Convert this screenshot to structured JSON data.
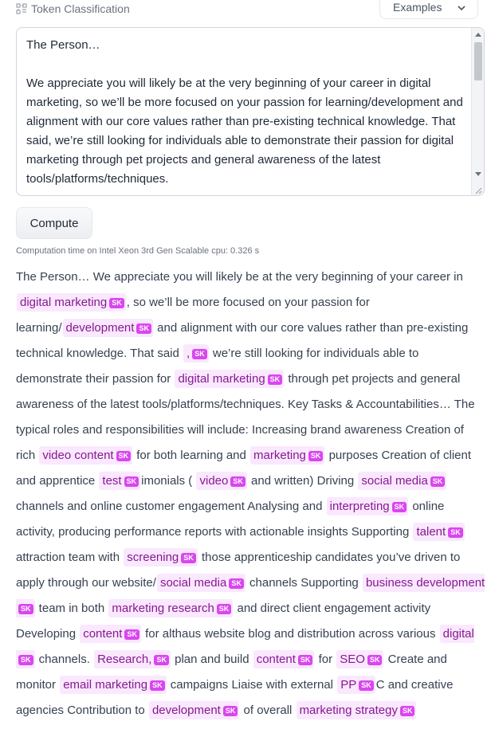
{
  "header": {
    "title": "Token Classification",
    "examples_label": "Examples"
  },
  "input": {
    "text": "The Person…\n\nWe appreciate you will likely be at the very beginning of your career in digital marketing, so we’ll be more focused on your passion for learning/development and alignment with our core values rather than pre-existing technical knowledge. That said, we’re still looking for individuals able to demonstrate their passion for digital marketing through pet projects and general awareness of the latest tools/platforms/techniques."
  },
  "compute_label": "Compute",
  "timing": "Computation time on Intel Xeon 3rd Gen Scalable cpu: 0.326 s",
  "output": {
    "segments": [
      {
        "t": "The Person… We appreciate you will likely be at the very beginning of your career in "
      },
      {
        "e": "digital marketing",
        "tag": "SK"
      },
      {
        "t": ", so we’ll be more focused on your passion for learning/"
      },
      {
        "e": "development",
        "tag": "SK"
      },
      {
        "t": " and alignment with our core values rather than pre-existing technical knowledge. That said "
      },
      {
        "e": ",",
        "tag": "SK"
      },
      {
        "t": " we’re still looking for individuals able to demonstrate their passion for "
      },
      {
        "e": "digital marketing",
        "tag": "SK"
      },
      {
        "t": " through pet projects and general awareness of the latest tools/platforms/techniques. Key Tasks & Accountabilities… The typical roles and responsibilities will include: Increasing brand awareness Creation of rich "
      },
      {
        "e": "video content",
        "tag": "SK"
      },
      {
        "t": " for both learning and "
      },
      {
        "e": "marketing",
        "tag": "SK"
      },
      {
        "t": " purposes Creation of client and apprentice "
      },
      {
        "e": "test",
        "tag": "SK"
      },
      {
        "t": "imonials ( "
      },
      {
        "e": "video",
        "tag": "SK"
      },
      {
        "t": " and written) Driving "
      },
      {
        "e": "social media",
        "tag": "SK"
      },
      {
        "t": " channels and online customer engagement Analysing and "
      },
      {
        "e": "interpreting",
        "tag": "SK"
      },
      {
        "t": " online activity, producing performance reports with actionable insights Supporting "
      },
      {
        "e": "talent",
        "tag": "SK"
      },
      {
        "t": " attraction team with "
      },
      {
        "e": "screening",
        "tag": "SK"
      },
      {
        "t": " those apprenticeship candidates you’ve driven to apply through our website/"
      },
      {
        "e": "social media",
        "tag": "SK"
      },
      {
        "t": " channels Supporting "
      },
      {
        "e": "business development",
        "tag": "SK"
      },
      {
        "t": " team in both "
      },
      {
        "e": "marketing research",
        "tag": "SK"
      },
      {
        "t": " and direct client engagement activity Developing "
      },
      {
        "e": "content",
        "tag": "SK"
      },
      {
        "t": " for althaus website blog and distribution across various "
      },
      {
        "e": "digital",
        "tag": "SK"
      },
      {
        "t": " channels. "
      },
      {
        "e": "Research,",
        "tag": "SK"
      },
      {
        "t": " plan and build "
      },
      {
        "e": "content",
        "tag": "SK"
      },
      {
        "t": " for "
      },
      {
        "e": "SEO",
        "tag": "SK"
      },
      {
        "t": " Create and monitor "
      },
      {
        "e": "email marketing",
        "tag": "SK"
      },
      {
        "t": " campaigns Liaise with external "
      },
      {
        "e": "PP",
        "tag": "SK"
      },
      {
        "t": "C and creative agencies Contribution to "
      },
      {
        "e": "development",
        "tag": "SK"
      },
      {
        "t": " of overall "
      },
      {
        "e": "marketing strategy",
        "tag": "SK"
      }
    ]
  }
}
